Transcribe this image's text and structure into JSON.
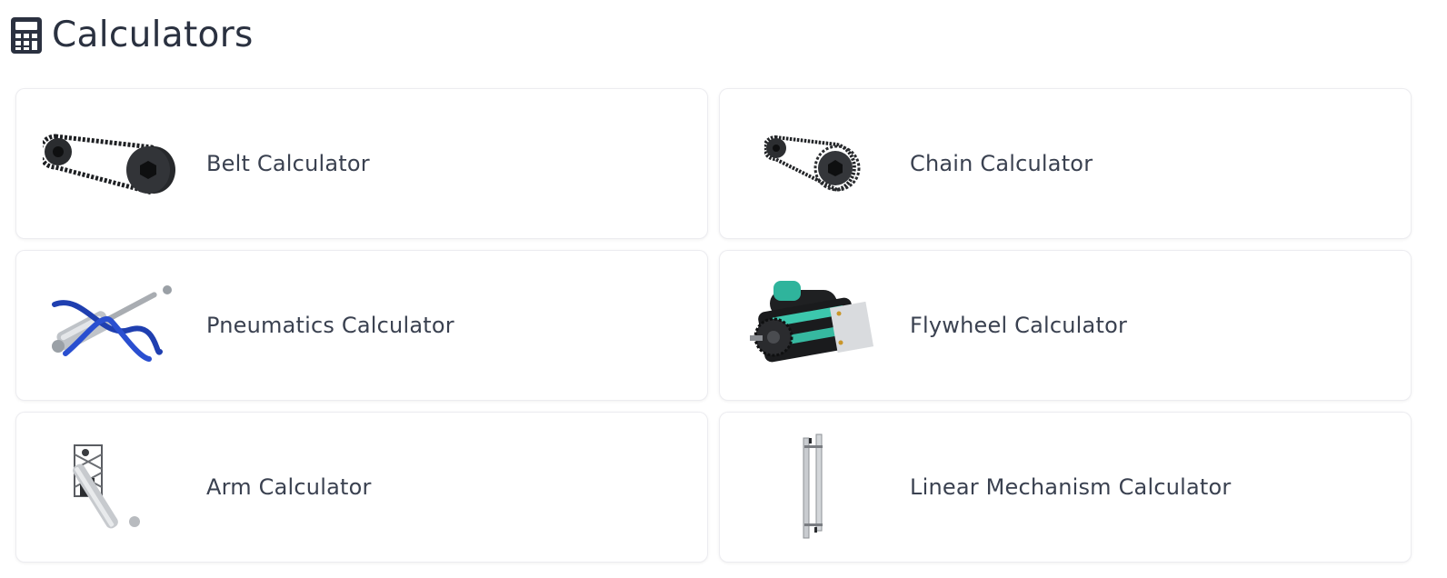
{
  "page": {
    "title": "Calculators",
    "icon": "calculator-icon"
  },
  "colors": {
    "title_text": "#2a3140",
    "card_text": "#3a4150",
    "card_border": "#ececf0",
    "icon_dark": "#2b3140"
  },
  "calculators": [
    {
      "label": "Belt Calculator",
      "thumbnail": "belt-pulley-icon"
    },
    {
      "label": "Chain Calculator",
      "thumbnail": "chain-sprocket-icon"
    },
    {
      "label": "Pneumatics Calculator",
      "thumbnail": "pneumatic-cylinder-icon"
    },
    {
      "label": "Flywheel Calculator",
      "thumbnail": "flywheel-shooter-icon"
    },
    {
      "label": "Arm Calculator",
      "thumbnail": "arm-mechanism-icon"
    },
    {
      "label": "Linear Mechanism Calculator",
      "thumbnail": "linear-elevator-icon"
    }
  ]
}
